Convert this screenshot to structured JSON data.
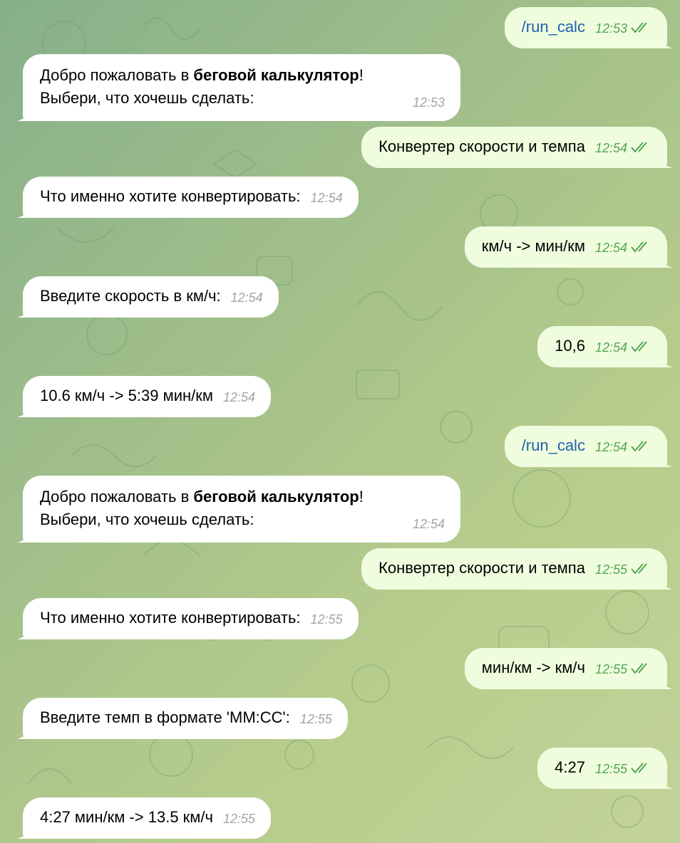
{
  "colors": {
    "outgoing_bubble": "#effdde",
    "incoming_bubble": "#ffffff",
    "outgoing_time": "#53a551",
    "incoming_time": "#a3a3a3",
    "command_link": "#1f5fb0"
  },
  "messages": [
    {
      "dir": "out",
      "text": "/run_calc",
      "time": "12:53"
    },
    {
      "dir": "in",
      "prefix": "Добро пожаловать в ",
      "bold": "беговой калькулятор",
      "suffix": "!",
      "line2": "Выбери, что хочешь сделать:",
      "time": "12:53"
    },
    {
      "dir": "out",
      "text": "Конвертер скорости и темпа",
      "time": "12:54"
    },
    {
      "dir": "in",
      "text": "Что именно хотите конвертировать:",
      "time": "12:54"
    },
    {
      "dir": "out",
      "text": "км/ч -> мин/км",
      "time": "12:54"
    },
    {
      "dir": "in",
      "text": "Введите скорость в км/ч:",
      "time": "12:54"
    },
    {
      "dir": "out",
      "text": "10,6",
      "time": "12:54"
    },
    {
      "dir": "in",
      "text": "10.6 км/ч -> 5:39 мин/км",
      "time": "12:54"
    },
    {
      "dir": "out",
      "text": "/run_calc",
      "time": "12:54"
    },
    {
      "dir": "in",
      "prefix": "Добро пожаловать в ",
      "bold": "беговой калькулятор",
      "suffix": "!",
      "line2": "Выбери, что хочешь сделать:",
      "time": "12:54"
    },
    {
      "dir": "out",
      "text": "Конвертер скорости и темпа",
      "time": "12:55"
    },
    {
      "dir": "in",
      "text": "Что именно хотите конвертировать:",
      "time": "12:55"
    },
    {
      "dir": "out",
      "text": "мин/км -> км/ч",
      "time": "12:55"
    },
    {
      "dir": "in",
      "text": "Введите темп в формате 'ММ:СС':",
      "time": "12:55"
    },
    {
      "dir": "out",
      "text": "4:27",
      "time": "12:55"
    },
    {
      "dir": "in",
      "text": "4:27 мин/км -> 13.5 км/ч",
      "time": "12:55"
    }
  ]
}
